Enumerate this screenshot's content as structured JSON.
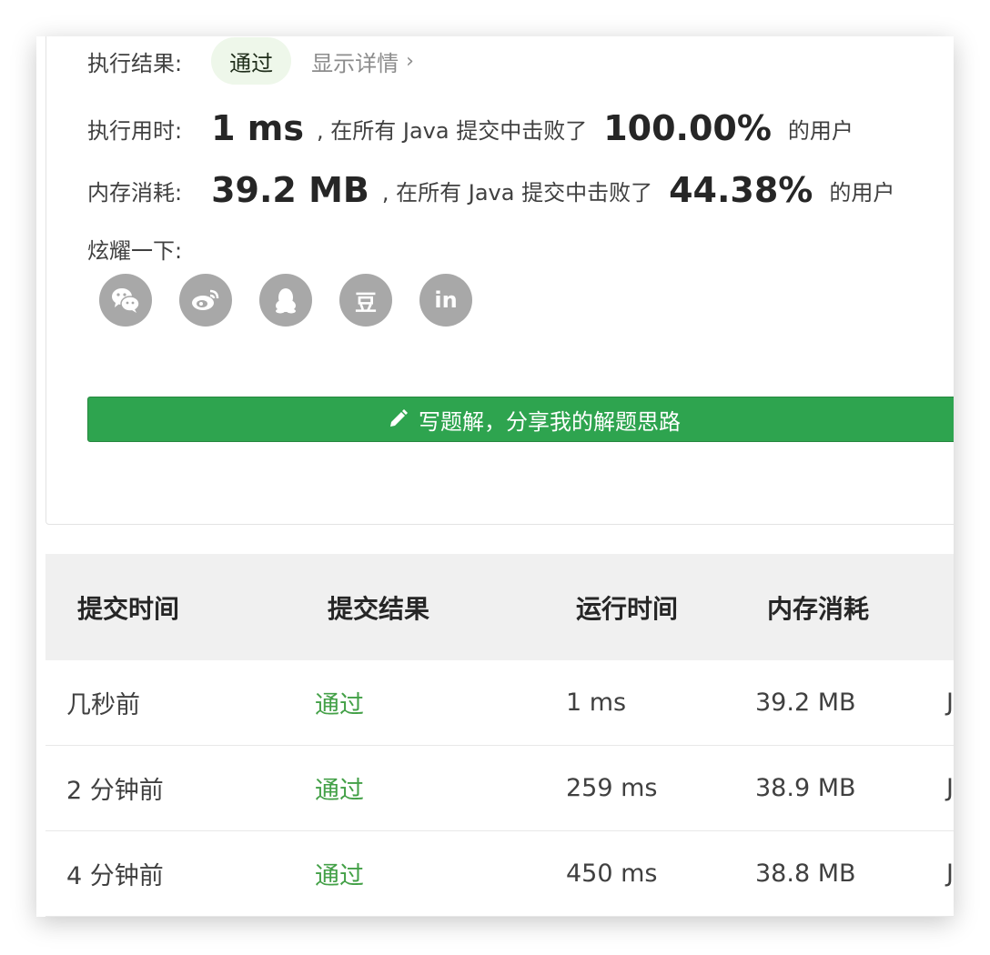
{
  "result": {
    "exec_label": "执行结果:",
    "status": "通过",
    "detail_link": "显示详情",
    "time_label": "执行用时:",
    "time_value": "1 ms",
    "beat_text": ", 在所有 Java 提交中击败了",
    "time_percent": "100.00%",
    "users_suffix": "的用户",
    "memory_label": "内存消耗:",
    "memory_value": "39.2 MB",
    "memory_percent": "44.38%",
    "share_label": "炫耀一下:"
  },
  "share_icons": [
    {
      "name": "wechat-icon"
    },
    {
      "name": "weibo-icon"
    },
    {
      "name": "qq-icon"
    },
    {
      "name": "douban-icon",
      "glyph": "豆"
    },
    {
      "name": "linkedin-icon",
      "glyph": "in"
    }
  ],
  "write_button": "写题解，分享我的解题思路",
  "table": {
    "headers": [
      "提交时间",
      "提交结果",
      "运行时间",
      "内存消耗"
    ],
    "rows": [
      {
        "time": "几秒前",
        "result": "通过",
        "runtime": "1 ms",
        "memory": "39.2 MB",
        "lang": "J"
      },
      {
        "time": "2 分钟前",
        "result": "通过",
        "runtime": "259 ms",
        "memory": "38.9 MB",
        "lang": "J"
      },
      {
        "time": "4 分钟前",
        "result": "通过",
        "runtime": "450 ms",
        "memory": "38.8 MB",
        "lang": "J"
      }
    ]
  },
  "colors": {
    "pass_green": "#43a047",
    "button_green": "#2ea44f",
    "pill_bg": "#eef7ea",
    "icon_gray": "#a8a8a8"
  }
}
